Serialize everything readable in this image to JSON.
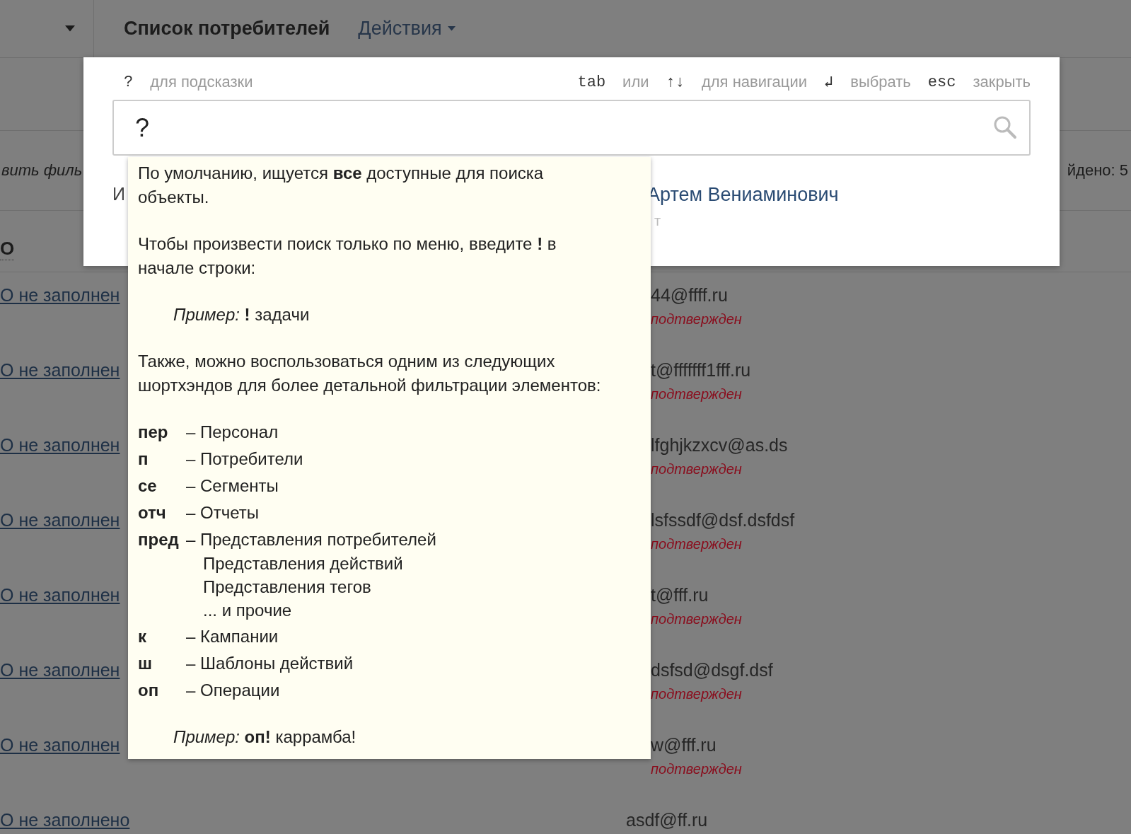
{
  "header": {
    "title": "Список потребителей",
    "actions_menu": "Действия"
  },
  "filter_bar": {
    "filter_link": "вить филь",
    "found_count": "йдено: 5"
  },
  "table": {
    "column_1": "О",
    "rows": [
      {
        "name": "О не заполнен",
        "email": "44@ffff.ru",
        "status": "подтвержден"
      },
      {
        "name": "О не заполнен",
        "email": "t@fffffff1fff.ru",
        "status": "подтвержден"
      },
      {
        "name": "О не заполнен",
        "email": "lfghjkzxcv@as.ds",
        "status": "подтвержден"
      },
      {
        "name": "О не заполнен",
        "email": "lsfssdf@dsf.dsfdsf",
        "status": "подтвержден"
      },
      {
        "name": "О не заполнен",
        "email": "t@fff.ru",
        "status": "подтвержден"
      },
      {
        "name": "О не заполнен",
        "email": "dsfsd@dsgf.dsf",
        "status": "подтвержден"
      },
      {
        "name": "О не заполнен",
        "email": "w@fff.ru",
        "status": "подтвержден"
      },
      {
        "name": "О не заполнено",
        "email": "asdf@ff.ru"
      }
    ]
  },
  "search_dialog": {
    "hints_left": [
      {
        "kind": "key",
        "text": "?"
      },
      {
        "kind": "label",
        "text": "для подсказки"
      }
    ],
    "hints_right": [
      {
        "kind": "key",
        "text": "tab"
      },
      {
        "kind": "label",
        "text": "или"
      },
      {
        "kind": "key",
        "text": "↑↓"
      },
      {
        "kind": "label",
        "text": "для навигации"
      },
      {
        "kind": "key",
        "text": "↲"
      },
      {
        "kind": "label",
        "text": "выбрать"
      },
      {
        "kind": "key",
        "text": "esc"
      },
      {
        "kind": "label",
        "text": "закрыть"
      }
    ],
    "input_value": "?",
    "result": {
      "left_fragment": "И",
      "name": "Артем Вениаминович",
      "subtitle": "т"
    }
  },
  "help_popup": {
    "paragraphs": [
      "По умолчанию, ищуется **все** доступные для поиска объекты.",
      "Чтобы произвести поиск только по меню, введите **!** в начале строки:"
    ],
    "example_1": "*Пример:* **!** задачи",
    "intro": "Также, можно воспользоваться одним из следующих шортхэндов для более детальной фильтрации элементов:",
    "shortcuts": [
      {
        "key": "пер",
        "lines": [
          "– Персонал"
        ]
      },
      {
        "key": "п",
        "lines": [
          "– Потребители"
        ]
      },
      {
        "key": "се",
        "lines": [
          "– Сегменты"
        ]
      },
      {
        "key": "отч",
        "lines": [
          "– Отчеты"
        ]
      },
      {
        "key": "пред",
        "lines": [
          "– Представления потребителей",
          "Представления действий",
          "Представления тегов",
          "... и прочие"
        ]
      },
      {
        "key": "к",
        "lines": [
          "– Кампании"
        ]
      },
      {
        "key": "ш",
        "lines": [
          "– Шаблоны действий"
        ]
      },
      {
        "key": "оп",
        "lines": [
          "– Операции"
        ]
      }
    ],
    "example_2": "*Пример:* **оп!** каррамба!"
  }
}
